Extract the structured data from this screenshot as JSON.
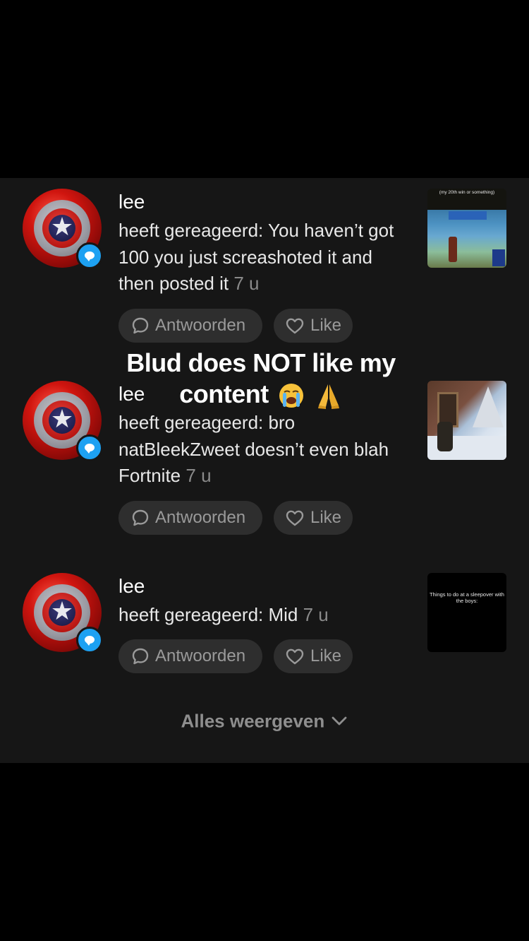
{
  "notifications": [
    {
      "name": "lee",
      "message": "heeft gereageerd: You haven’t got 100 you just screashoted it and then posted it",
      "time": "7 u",
      "reply_label": "Antwoorden",
      "like_label": "Like",
      "thumbnail_caption": "(my 20th win or something)"
    },
    {
      "name": "lee",
      "message": "heeft gereageerd: bro natBleekZweet doesn’t even blah Fortnite",
      "time": "7 u",
      "reply_label": "Antwoorden",
      "like_label": "Like",
      "thumbnail_caption": ""
    },
    {
      "name": "lee",
      "message": "heeft gereageerd: Mid",
      "time": "7 u",
      "reply_label": "Antwoorden",
      "like_label": "Like",
      "thumbnail_caption": "Things to do at a sleepover with the boys:"
    }
  ],
  "overlay_text": {
    "line1": "Blud does NOT like my",
    "line2": "content"
  },
  "show_all_label": "Alles weergeven",
  "colors": {
    "background": "#000000",
    "panel": "#161616",
    "pill": "#2e2e2e",
    "badge": "#1da1f2",
    "muted_text": "#8a8a8a"
  },
  "icons": [
    "comment-badge-icon",
    "reply-bubble-icon",
    "heart-icon",
    "chevron-down-icon",
    "loudly-crying-emoji",
    "folded-hands-emoji"
  ]
}
